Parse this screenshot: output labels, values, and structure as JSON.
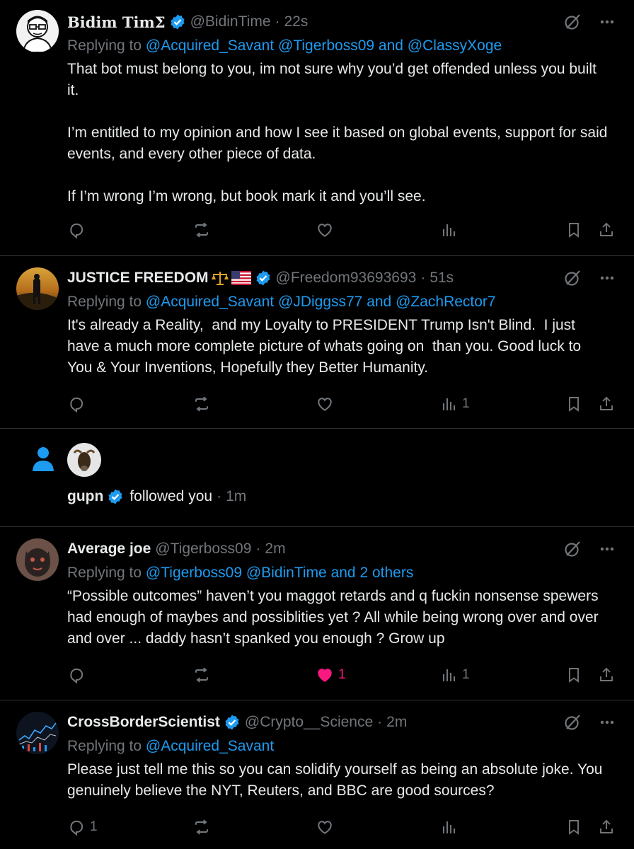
{
  "posts": [
    {
      "name": "Bidim TimΣ",
      "handle": "@BidinTime",
      "time": "22s",
      "reply_prefix": "Replying to",
      "mentions": "@Acquired_Savant @Tigerboss09 and @ClassyXoge",
      "body": "That bot must belong to you, im not sure why you’d get offended unless you built it.\n\nI’m entitled to my opinion and how I see it based on global events, support for said events, and every other piece of data.\n\nIf I’m wrong I’m wrong, but book mark it and you’ll see.",
      "counts": {
        "reply": "",
        "repost": "",
        "like": "",
        "views": ""
      }
    },
    {
      "name": "JUSTICE FREEDOM",
      "handle": "@Freedom93693693",
      "time": "51s",
      "reply_prefix": "Replying to",
      "mentions": "@Acquired_Savant @JDiggss77 and @ZachRector7",
      "body": "It's already a Reality,  and my Loyalty to PRESIDENT Trump Isn't Blind.  I just have a much more complete picture of whats going on  than you. Good luck to You & Your Inventions, Hopefully they Better Humanity.",
      "counts": {
        "reply": "",
        "repost": "",
        "like": "",
        "views": "1"
      }
    },
    {
      "name": "Average joe",
      "handle": "@Tigerboss09",
      "time": "2m",
      "reply_prefix": "Replying to",
      "mentions": "@Tigerboss09 @BidinTime and 2 others",
      "body": "“Possible outcomes” haven’t you maggot retards and q fuckin nonsense spewers had enough of maybes and possiblities yet ? All while being wrong over and over and over ... daddy hasn’t spanked you enough ? Grow up",
      "counts": {
        "reply": "",
        "repost": "",
        "like": "1",
        "views": "1"
      }
    },
    {
      "name": "CrossBorderScientist",
      "handle": "@Crypto__Science",
      "time": "2m",
      "reply_prefix": "Replying to",
      "mentions": "@Acquired_Savant",
      "body": "Please just tell me this so you can solidify yourself as being an absolute joke. You genuinely believe the NYT, Reuters, and BBC are good sources?",
      "counts": {
        "reply": "1",
        "repost": "",
        "like": "",
        "views": ""
      }
    }
  ],
  "notification": {
    "name": "gupn",
    "text": "followed you",
    "time": "1m"
  },
  "colors": {
    "background": "#000000",
    "text": "#e7e9ea",
    "muted": "#71767b",
    "accent": "#1d9bf0",
    "like": "#f91880",
    "divider": "#2f3336"
  },
  "icons": [
    "grok-icon",
    "more-icon",
    "reply-icon",
    "repost-icon",
    "like-icon",
    "views-icon",
    "bookmark-icon",
    "share-icon",
    "verified-icon",
    "person-icon"
  ]
}
